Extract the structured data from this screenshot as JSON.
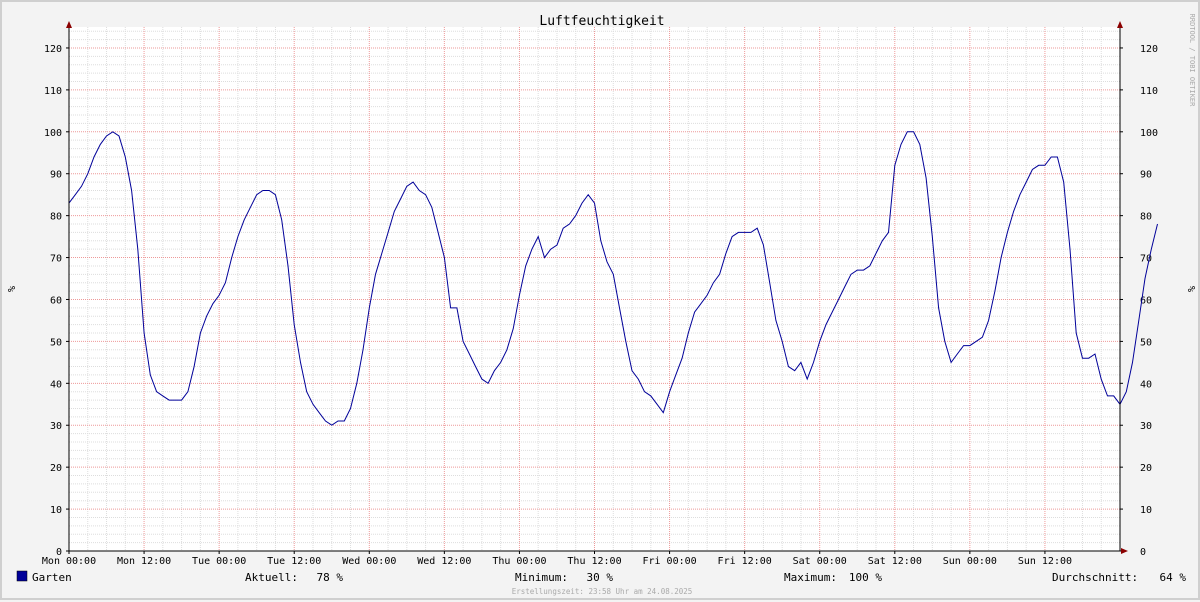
{
  "chart_data": {
    "type": "line",
    "title": "Luftfeuchtigkeit",
    "ylabel_left": "%",
    "ylabel_right": "%",
    "watermark": "RRDTOOL / TOBI OETIKER",
    "ylim": [
      0,
      125
    ],
    "yticks": [
      0,
      10,
      20,
      30,
      40,
      50,
      60,
      70,
      80,
      90,
      100,
      110,
      120
    ],
    "xlim_hours": [
      0,
      168
    ],
    "xticks": [
      {
        "h": 0,
        "label": "Mon 00:00"
      },
      {
        "h": 12,
        "label": "Mon 12:00"
      },
      {
        "h": 24,
        "label": "Tue 00:00"
      },
      {
        "h": 36,
        "label": "Tue 12:00"
      },
      {
        "h": 48,
        "label": "Wed 00:00"
      },
      {
        "h": 60,
        "label": "Wed 12:00"
      },
      {
        "h": 72,
        "label": "Thu 00:00"
      },
      {
        "h": 84,
        "label": "Thu 12:00"
      },
      {
        "h": 96,
        "label": "Fri 00:00"
      },
      {
        "h": 108,
        "label": "Fri 12:00"
      },
      {
        "h": 120,
        "label": "Sat 00:00"
      },
      {
        "h": 132,
        "label": "Sat 12:00"
      },
      {
        "h": 144,
        "label": "Sun 00:00"
      },
      {
        "h": 156,
        "label": "Sun 12:00"
      }
    ],
    "series": [
      {
        "name": "Garten",
        "color": "#000099",
        "points": [
          [
            0,
            83
          ],
          [
            1,
            85
          ],
          [
            2,
            87
          ],
          [
            3,
            90
          ],
          [
            4,
            94
          ],
          [
            5,
            97
          ],
          [
            6,
            99
          ],
          [
            7,
            100
          ],
          [
            8,
            99
          ],
          [
            9,
            94
          ],
          [
            10,
            86
          ],
          [
            11,
            72
          ],
          [
            12,
            52
          ],
          [
            13,
            42
          ],
          [
            14,
            38
          ],
          [
            15,
            37
          ],
          [
            16,
            36
          ],
          [
            17,
            36
          ],
          [
            18,
            36
          ],
          [
            19,
            38
          ],
          [
            20,
            44
          ],
          [
            21,
            52
          ],
          [
            22,
            56
          ],
          [
            23,
            59
          ],
          [
            24,
            61
          ],
          [
            25,
            64
          ],
          [
            26,
            70
          ],
          [
            27,
            75
          ],
          [
            28,
            79
          ],
          [
            29,
            82
          ],
          [
            30,
            85
          ],
          [
            31,
            86
          ],
          [
            32,
            86
          ],
          [
            33,
            85
          ],
          [
            34,
            79
          ],
          [
            35,
            68
          ],
          [
            36,
            54
          ],
          [
            37,
            45
          ],
          [
            38,
            38
          ],
          [
            39,
            35
          ],
          [
            40,
            33
          ],
          [
            41,
            31
          ],
          [
            42,
            30
          ],
          [
            43,
            31
          ],
          [
            44,
            31
          ],
          [
            45,
            34
          ],
          [
            46,
            40
          ],
          [
            47,
            48
          ],
          [
            48,
            58
          ],
          [
            49,
            66
          ],
          [
            50,
            71
          ],
          [
            51,
            76
          ],
          [
            52,
            81
          ],
          [
            53,
            84
          ],
          [
            54,
            87
          ],
          [
            55,
            88
          ],
          [
            56,
            86
          ],
          [
            57,
            85
          ],
          [
            58,
            82
          ],
          [
            59,
            76
          ],
          [
            60,
            70
          ],
          [
            61,
            58
          ],
          [
            62,
            58
          ],
          [
            63,
            50
          ],
          [
            64,
            47
          ],
          [
            65,
            44
          ],
          [
            66,
            41
          ],
          [
            67,
            40
          ],
          [
            68,
            43
          ],
          [
            69,
            45
          ],
          [
            70,
            48
          ],
          [
            71,
            53
          ],
          [
            72,
            61
          ],
          [
            73,
            68
          ],
          [
            74,
            72
          ],
          [
            75,
            75
          ],
          [
            76,
            70
          ],
          [
            77,
            72
          ],
          [
            78,
            73
          ],
          [
            79,
            77
          ],
          [
            80,
            78
          ],
          [
            81,
            80
          ],
          [
            82,
            83
          ],
          [
            83,
            85
          ],
          [
            84,
            83
          ],
          [
            85,
            74
          ],
          [
            86,
            69
          ],
          [
            87,
            66
          ],
          [
            88,
            58
          ],
          [
            89,
            50
          ],
          [
            90,
            43
          ],
          [
            91,
            41
          ],
          [
            92,
            38
          ],
          [
            93,
            37
          ],
          [
            94,
            35
          ],
          [
            95,
            33
          ],
          [
            96,
            38
          ],
          [
            97,
            42
          ],
          [
            98,
            46
          ],
          [
            99,
            52
          ],
          [
            100,
            57
          ],
          [
            101,
            59
          ],
          [
            102,
            61
          ],
          [
            103,
            64
          ],
          [
            104,
            66
          ],
          [
            105,
            71
          ],
          [
            106,
            75
          ],
          [
            107,
            76
          ],
          [
            108,
            76
          ],
          [
            109,
            76
          ],
          [
            110,
            77
          ],
          [
            111,
            73
          ],
          [
            112,
            64
          ],
          [
            113,
            55
          ],
          [
            114,
            50
          ],
          [
            115,
            44
          ],
          [
            116,
            43
          ],
          [
            117,
            45
          ],
          [
            118,
            41
          ],
          [
            119,
            45
          ],
          [
            120,
            50
          ],
          [
            121,
            54
          ],
          [
            122,
            57
          ],
          [
            123,
            60
          ],
          [
            124,
            63
          ],
          [
            125,
            66
          ],
          [
            126,
            67
          ],
          [
            127,
            67
          ],
          [
            128,
            68
          ],
          [
            129,
            71
          ],
          [
            130,
            74
          ],
          [
            131,
            76
          ],
          [
            132,
            92
          ],
          [
            133,
            97
          ],
          [
            134,
            100
          ],
          [
            135,
            100
          ],
          [
            136,
            97
          ],
          [
            137,
            89
          ],
          [
            138,
            75
          ],
          [
            139,
            58
          ],
          [
            140,
            50
          ],
          [
            141,
            45
          ],
          [
            142,
            47
          ],
          [
            143,
            49
          ],
          [
            144,
            49
          ],
          [
            145,
            50
          ],
          [
            146,
            51
          ],
          [
            147,
            55
          ],
          [
            148,
            62
          ],
          [
            149,
            70
          ],
          [
            150,
            76
          ],
          [
            151,
            81
          ],
          [
            152,
            85
          ],
          [
            153,
            88
          ],
          [
            154,
            91
          ],
          [
            155,
            92
          ],
          [
            156,
            92
          ],
          [
            157,
            94
          ],
          [
            158,
            94
          ],
          [
            159,
            88
          ],
          [
            160,
            72
          ],
          [
            161,
            52
          ],
          [
            162,
            46
          ],
          [
            163,
            46
          ],
          [
            164,
            47
          ],
          [
            165,
            41
          ],
          [
            166,
            37
          ],
          [
            167,
            37
          ],
          [
            168,
            35
          ],
          [
            169,
            38
          ],
          [
            170,
            45
          ],
          [
            171,
            55
          ],
          [
            172,
            65
          ],
          [
            173,
            72
          ],
          [
            174,
            78
          ]
        ]
      }
    ],
    "legend": {
      "series_name": "Garten",
      "swatch_color": "#000099",
      "aktuell_label": "Aktuell:",
      "aktuell_value": "78 %",
      "minimum_label": "Minimum:",
      "minimum_value": "30 %",
      "maximum_label": "Maximum:",
      "maximum_value": "100 %",
      "durchschnitt_label": "Durchschnitt:",
      "durchschnitt_value": "64 %"
    },
    "footer": "Erstellungszeit: 23:58 Uhr am 24.08.2025",
    "colors": {
      "background": "#f3f3f3",
      "plot_background": "#ffffff",
      "minor_grid": "#dddddd",
      "major_grid": "#ee9999",
      "axis": "#000000",
      "arrow": "#8b0000"
    }
  }
}
